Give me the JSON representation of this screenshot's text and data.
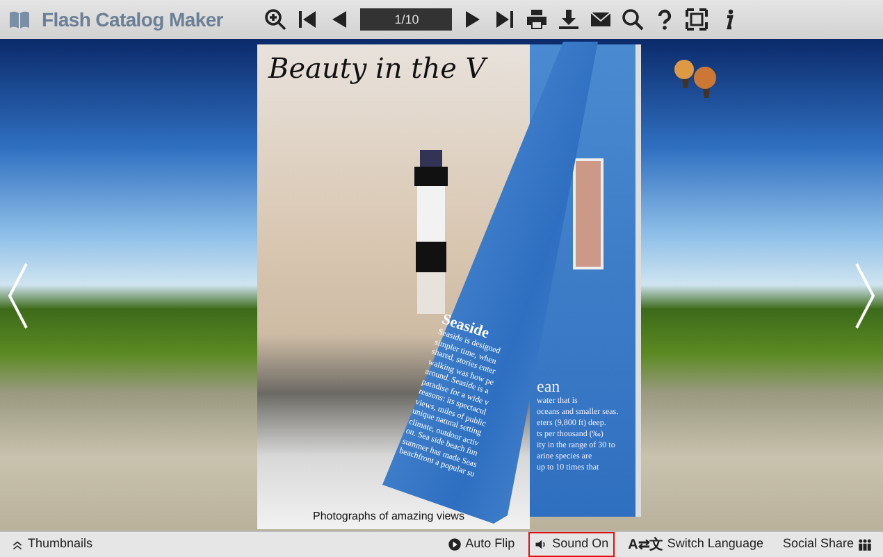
{
  "toolbar": {
    "logo_text": "Flash Catalog Maker",
    "page_field": {
      "value": "1/10"
    },
    "tools": [
      {
        "kind": "zoom-in"
      },
      {
        "kind": "first"
      },
      {
        "kind": "prev"
      },
      {
        "kind": "page"
      },
      {
        "kind": "next"
      },
      {
        "kind": "last"
      },
      {
        "kind": "print"
      },
      {
        "kind": "download"
      },
      {
        "kind": "mail"
      },
      {
        "kind": "search"
      },
      {
        "kind": "help"
      },
      {
        "kind": "fullscreen"
      },
      {
        "kind": "info"
      }
    ]
  },
  "book": {
    "left_page": {
      "title": "Beauty in the V",
      "caption": "Photographs of amazing views"
    },
    "turning_page": {
      "heading": "Seaside",
      "lines": [
        "Seaside is designed",
        "simpler time, when",
        "shared, stories enter",
        "walking was how pe",
        "around. Seaside is a",
        "paradise for a wide v",
        "reasons: its spectacul",
        "views, miles of public",
        "unique natural setting",
        "climate, outdoor activ",
        "on. Sea side beach fun",
        "summer has made Seas",
        "beachfront a popular su"
      ]
    },
    "right_page": {
      "heading": "ean",
      "lines": [
        "water that is",
        "oceans and smaller seas.",
        "eters (9,800 ft) deep.",
        "ts per thousand (‰)",
        "ity in the range of 30 to",
        "arine species are",
        "up to 10 times that"
      ]
    }
  },
  "bottom_bar": {
    "thumbnails": "Thumbnails",
    "items": [
      {
        "kind": "autoflip",
        "label": "Auto Flip",
        "highlighted": false
      },
      {
        "kind": "sound",
        "label": "Sound On",
        "highlighted": true
      },
      {
        "kind": "language",
        "icon_text": "A⇄文",
        "label": "Switch Language",
        "highlighted": false
      },
      {
        "kind": "share",
        "label": "Social Share",
        "highlighted": false
      }
    ]
  }
}
